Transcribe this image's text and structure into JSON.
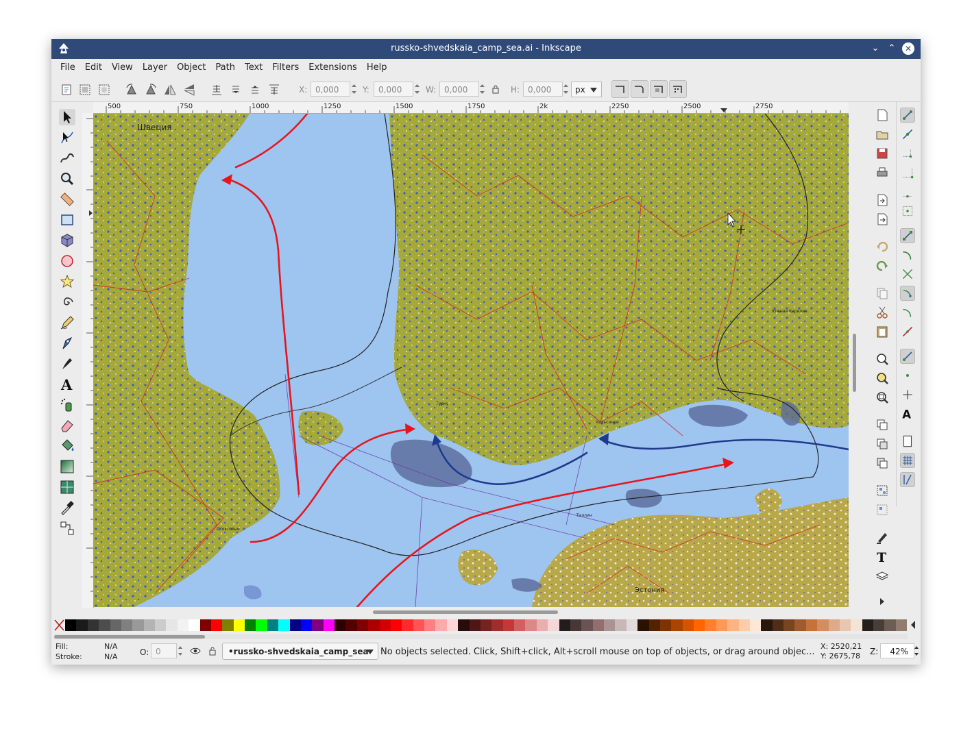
{
  "window": {
    "title": "russko-shvedskaia_camp_sea.ai - Inkscape"
  },
  "menu": [
    "File",
    "Edit",
    "View",
    "Layer",
    "Object",
    "Path",
    "Text",
    "Filters",
    "Extensions",
    "Help"
  ],
  "toolbar": {
    "x_label": "X:",
    "x_value": "0,000",
    "y_label": "Y:",
    "y_value": "0,000",
    "w_label": "W:",
    "w_value": "0,000",
    "h_label": "H:",
    "h_value": "0,000",
    "unit": "px"
  },
  "ruler": {
    "h_ticks": [
      "500",
      "750",
      "1000",
      "1250",
      "1500",
      "1750",
      "2k",
      "2250",
      "2500",
      "2750"
    ]
  },
  "map_labels": {
    "sweden": "Швеция",
    "estonia": "Эстония",
    "helsinki": "Хельсинки",
    "tallinn": "Таллин",
    "stockholm": "Стокгольм",
    "turku": "Турку",
    "south_karelia": "Южная Карелия"
  },
  "palette_colors": [
    "#000000",
    "#1a1a1a",
    "#333333",
    "#4d4d4d",
    "#666666",
    "#808080",
    "#999999",
    "#b3b3b3",
    "#cccccc",
    "#e6e6e6",
    "#f2f2f2",
    "#ffffff",
    "#800000",
    "#ff0000",
    "#808000",
    "#ffff00",
    "#008000",
    "#00ff00",
    "#008080",
    "#00ffff",
    "#000080",
    "#0000ff",
    "#800080",
    "#ff00ff",
    "#2b0000",
    "#550000",
    "#800000",
    "#aa0000",
    "#d40000",
    "#ff0000",
    "#ff2a2a",
    "#ff5555",
    "#ff8080",
    "#ffaaaa",
    "#ffd5d5",
    "#280b0b",
    "#501616",
    "#782121",
    "#a02c2c",
    "#c83737",
    "#d35f5f",
    "#de8787",
    "#e9afaf",
    "#f4d7d7",
    "#241c1c",
    "#483737",
    "#6c5353",
    "#916f6f",
    "#ac9393",
    "#c8b7b7",
    "#e3dbdb",
    "#2b1100",
    "#552200",
    "#803300",
    "#aa4400",
    "#d45500",
    "#ff6600",
    "#ff7f2a",
    "#ff9955",
    "#ffb380",
    "#ffccaa",
    "#ffe6d5",
    "#28170b",
    "#502d16",
    "#784421",
    "#a05a2c",
    "#c87137",
    "#d38d5f",
    "#deaa87",
    "#e9c6af",
    "#f4e3d7",
    "#241f1c",
    "#483e37",
    "#6c5d53",
    "#917c6f"
  ],
  "status": {
    "fill_label": "Fill:",
    "fill_value": "N/A",
    "stroke_label": "Stroke:",
    "stroke_value": "N/A",
    "opacity_label": "O:",
    "opacity_value": "0",
    "layer": "•russko-shvedskaia_camp_sea",
    "message": "No objects selected. Click, Shift+click, Alt+scroll mouse on top of objects, or drag around objec...",
    "cursor_x": "X: 2520,21",
    "cursor_y": "Y: 2675,78",
    "zoom_label": "Z:",
    "zoom_value": "42%"
  }
}
